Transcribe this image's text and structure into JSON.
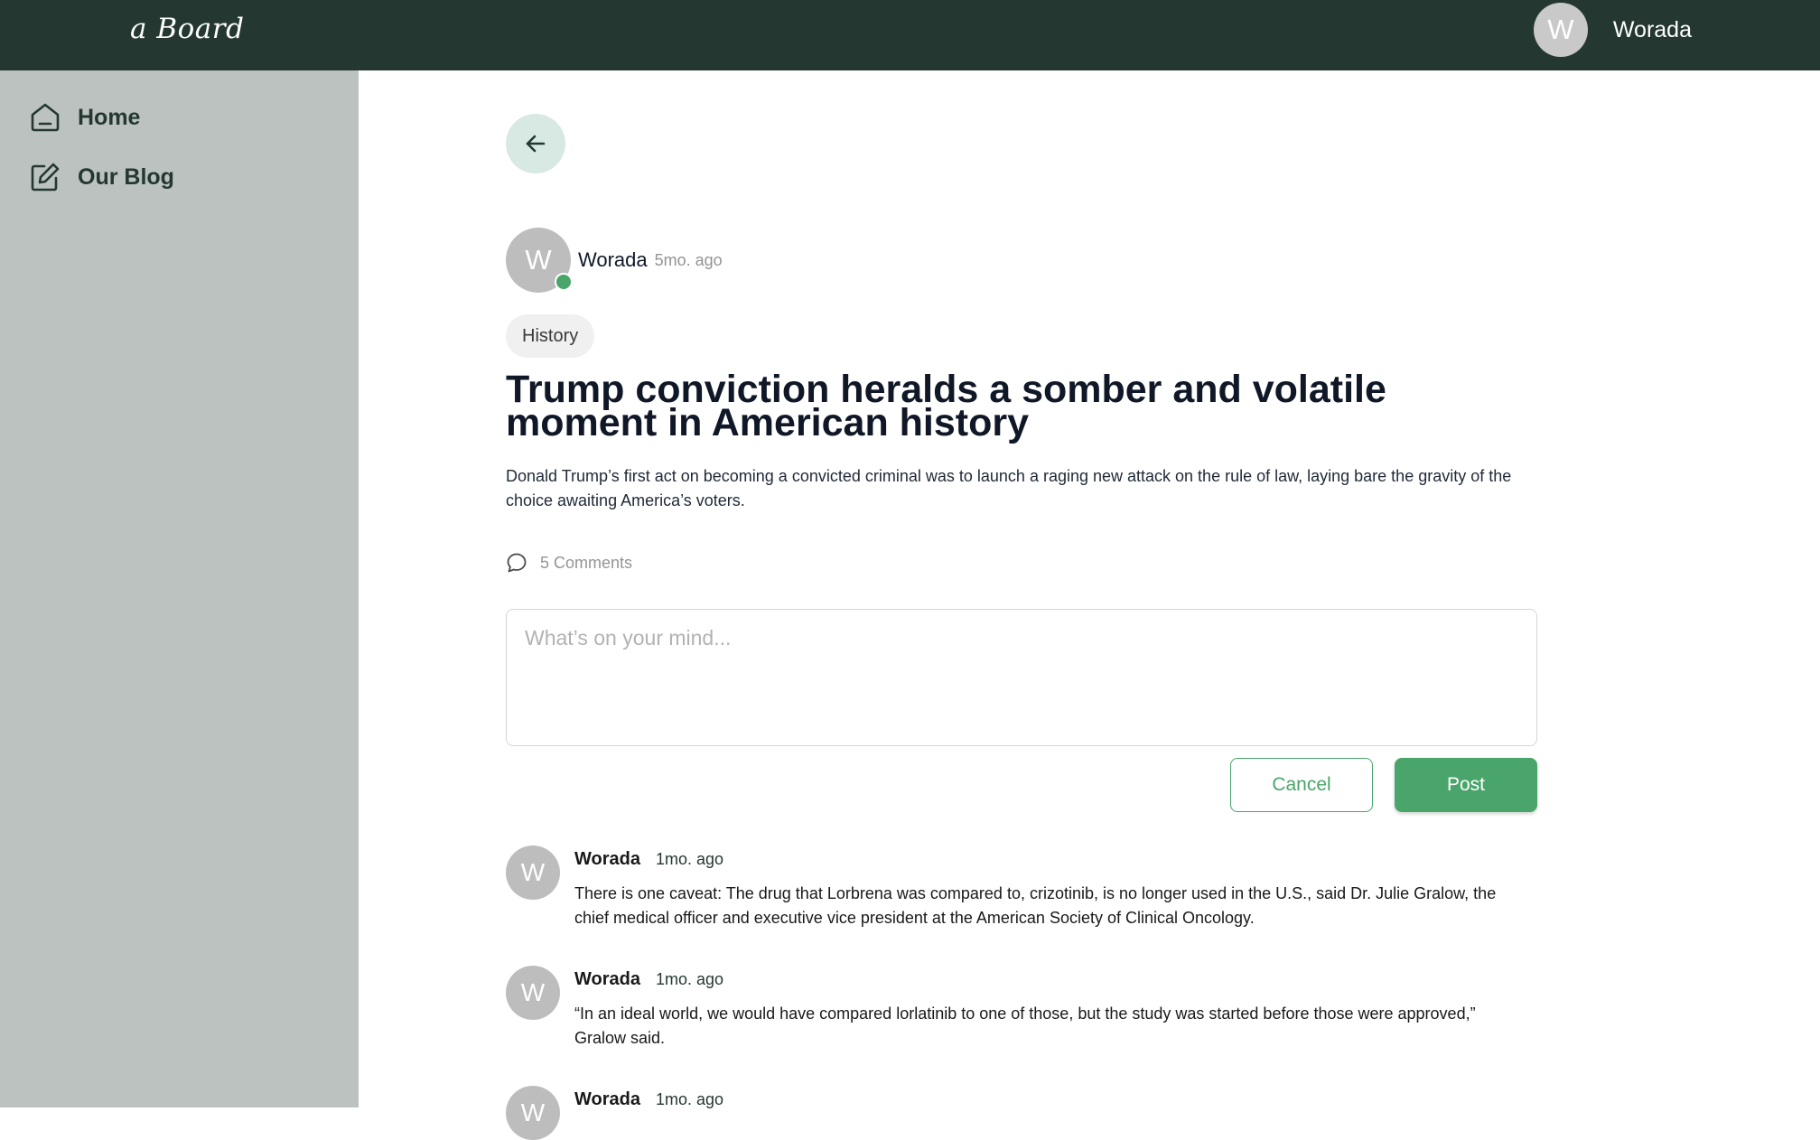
{
  "app": {
    "brand": "a Board"
  },
  "header": {
    "user": {
      "avatar_initial": "W",
      "name": "Worada"
    }
  },
  "sidebar": {
    "items": [
      {
        "label": "Home",
        "icon": "home-icon"
      },
      {
        "label": "Our Blog",
        "icon": "edit-icon"
      }
    ]
  },
  "post": {
    "author": {
      "avatar_initial": "W",
      "name": "Worada",
      "time": "5mo. ago",
      "online": true
    },
    "tag": "History",
    "title": "Trump conviction heralds a somber and volatile moment in American history",
    "description": "Donald Trump’s first act on becoming a convicted criminal was to launch a raging new attack on the rule of law, laying bare the gravity of the choice awaiting America’s voters.",
    "comments_label": "5 Comments"
  },
  "composer": {
    "placeholder": "What’s on your mind...",
    "value": "",
    "cancel_label": "Cancel",
    "post_label": "Post"
  },
  "comments": [
    {
      "avatar_initial": "W",
      "name": "Worada",
      "time": "1mo. ago",
      "text": "There is one caveat: The drug that Lorbrena was compared to, crizotinib, is no longer used in the U.S., said Dr. Julie Gralow, the chief medical officer and executive vice president at the American Society of Clinical Oncology."
    },
    {
      "avatar_initial": "W",
      "name": "Worada",
      "time": "1mo. ago",
      "text": "“In an ideal world, we would have compared lorlatinib to one of those, but the study was started before those were approved,” Gralow said."
    },
    {
      "avatar_initial": "W",
      "name": "Worada",
      "time": "1mo. ago",
      "text": ""
    }
  ],
  "colors": {
    "topbar": "#243831",
    "sidebar": "#bbc2bf",
    "accent_green": "#49a569",
    "back_button_bg": "#d8e9e4",
    "avatar_gray": "#bdbdbd"
  }
}
